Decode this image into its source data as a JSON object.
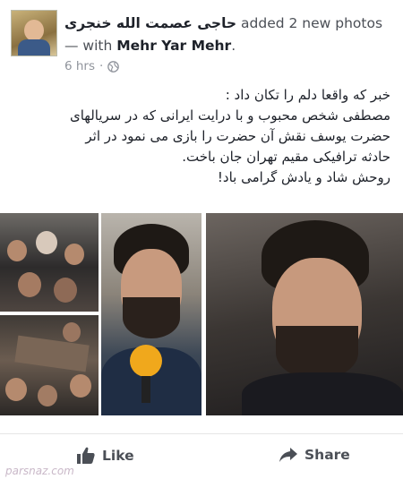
{
  "post": {
    "author": "حاجی عصمت الله خنجری",
    "action_text": "added 2 new photos — with",
    "tagged_user": "Mehr Yar Mehr",
    "tagged_suffix": ".",
    "time": "6 hrs",
    "separator": "·",
    "privacy_icon": "globe-icon",
    "body_lines": [
      "خبر که واقعا دلم را تکان داد :",
      "مصطفی شخص محبوب و با درایت ایرانی که در سریالهای",
      "حضرت یوسف نقش آن حضرت را بازی می نمود در اثر",
      "حادثه ترافیکی مقیم تهران جان باخت.",
      "روحش شاد و یادش گرامی باد!"
    ]
  },
  "actions": {
    "like_label": "Like",
    "like_icon": "thumbs-up-icon",
    "share_label": "Share",
    "share_icon": "share-arrow-icon"
  },
  "watermark": "parsnaz.com",
  "colors": {
    "text": "#1d2129",
    "muted": "#90949c",
    "action": "#4b4f56"
  }
}
